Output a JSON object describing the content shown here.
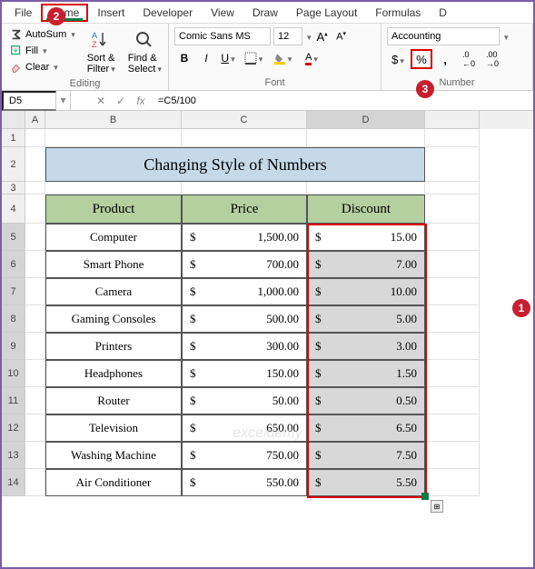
{
  "tabs": [
    "File",
    "Home",
    "Insert",
    "Developer",
    "View",
    "Draw",
    "Page Layout",
    "Formulas",
    "D"
  ],
  "active_tab": "Home",
  "ribbon": {
    "editing": {
      "autosum": "AutoSum",
      "fill": "Fill",
      "clear": "Clear",
      "sort": "Sort & Filter",
      "find": "Find & Select",
      "label": "Editing"
    },
    "font": {
      "name": "Comic Sans MS",
      "size": "12",
      "label": "Font"
    },
    "number": {
      "format": "Accounting",
      "label": "Number"
    }
  },
  "name_box": "D5",
  "formula": "=C5/100",
  "col_headers": [
    "A",
    "B",
    "C",
    "D"
  ],
  "title": "Changing Style of Numbers",
  "headers": {
    "product": "Product",
    "price": "Price",
    "discount": "Discount"
  },
  "currency": "$",
  "rows": [
    {
      "product": "Computer",
      "price": "1,500.00",
      "discount": "15.00"
    },
    {
      "product": "Smart Phone",
      "price": "700.00",
      "discount": "7.00"
    },
    {
      "product": "Camera",
      "price": "1,000.00",
      "discount": "10.00"
    },
    {
      "product": "Gaming Consoles",
      "price": "500.00",
      "discount": "5.00"
    },
    {
      "product": "Printers",
      "price": "300.00",
      "discount": "3.00"
    },
    {
      "product": "Headphones",
      "price": "150.00",
      "discount": "1.50"
    },
    {
      "product": "Router",
      "price": "50.00",
      "discount": "0.50"
    },
    {
      "product": "Television",
      "price": "650.00",
      "discount": "6.50"
    },
    {
      "product": "Washing Machine",
      "price": "750.00",
      "discount": "7.50"
    },
    {
      "product": "Air Conditioner",
      "price": "550.00",
      "discount": "5.50"
    }
  ],
  "watermark": "exceldemy"
}
